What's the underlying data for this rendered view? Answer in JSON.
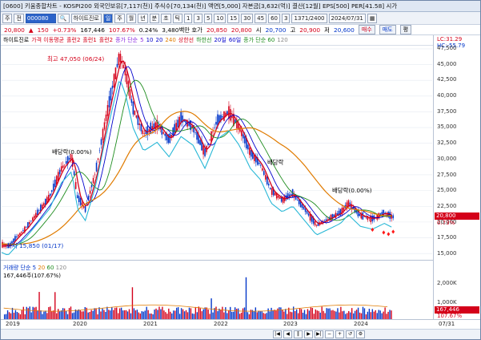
{
  "window": {
    "title": "[0600] 키움종합차트 - KOSPI200 외국인보유[7,117(천)] 주식수[70,134(천)] 액면[5,000] 자본금[3,632(억)] 결산[12월] EPS[500] PER[41.58] 시가"
  },
  "toolbar": {
    "period_labels": [
      "주",
      "전"
    ],
    "code_value": "000080",
    "stock_name": "하이트진로",
    "interval_buttons": [
      "일",
      "주",
      "월",
      "년",
      "분",
      "초",
      "틱"
    ],
    "minute_buttons": [
      "1",
      "3",
      "5",
      "10",
      "15",
      "30",
      "45",
      "60",
      "3"
    ],
    "count_value": "1371",
    "count_total": "2400",
    "date_value": "2024/07/31"
  },
  "pricebar": {
    "price": "20,800",
    "change_arrow": "▲",
    "change": "150",
    "change_pct": "+0.73%",
    "volume": "167,446",
    "volume_ratio": "107.67%",
    "turnover": "0.24%",
    "quote_label": "3,480백만 호가",
    "ask": "20,850",
    "bid": "20,800",
    "open_label": "시",
    "open": "20,700",
    "high_label": "고",
    "high": "20,900",
    "low_label": "저",
    "low": "20,600",
    "buy_btn": "매수",
    "sell_btn": "매도",
    "eval_btn": "평"
  },
  "legend": {
    "items": [
      {
        "text": "하이트진로",
        "color": "#000000"
      },
      {
        "text": "가격 이동평균",
        "color": "#d4001a"
      },
      {
        "text": "홀런2",
        "color": "#d4001a"
      },
      {
        "text": "홀런1",
        "color": "#d4001a"
      },
      {
        "text": "홀런2",
        "color": "#d4001a"
      },
      {
        "text": "종가 단순",
        "color": "#8a2be2"
      },
      {
        "text": "5",
        "color": "#8a2be2"
      },
      {
        "text": "10",
        "color": "#0000cc"
      },
      {
        "text": "20",
        "color": "#0000cc"
      },
      {
        "text": "240",
        "color": "#e07b00"
      },
      {
        "text": "상한선",
        "color": "#d4001a"
      },
      {
        "text": "하한선",
        "color": "#1e8c1e"
      },
      {
        "text": "20일",
        "color": "#0000cc"
      },
      {
        "text": "60일",
        "color": "#0000cc"
      },
      {
        "text": "종가 단순 60",
        "color": "#1e8c1e"
      },
      {
        "text": "120",
        "color": "#888888"
      }
    ]
  },
  "axis": {
    "lc": "LC:31.29",
    "hc": "HC:-55.79",
    "ticks": [
      "47,500",
      "45,000",
      "42,500",
      "40,000",
      "37,500",
      "35,000",
      "32,500",
      "30,000",
      "27,500",
      "25,000",
      "22,500",
      "20,000",
      "17,500",
      "15,000"
    ],
    "current_price": "20,800",
    "current_pct": "0.73%"
  },
  "annotations": {
    "high": "최고 47,050 (06/24)",
    "low": "최저 15,850 (01/17)",
    "div1": "배당락(0.00%)",
    "div2": "배당락",
    "div3": "배당락(0.00%)"
  },
  "volume": {
    "legend": "거래량 단순 5",
    "legend_extra": [
      "20",
      "60",
      "120"
    ],
    "value_line": "167,446주(107.67%)",
    "ticks": [
      "2,000K",
      "1,000K"
    ],
    "current": "167,446",
    "current_pct": "107.67%"
  },
  "xaxis": {
    "labels": [
      "2019",
      "2020",
      "2021",
      "2022",
      "2023",
      "2024"
    ],
    "last": "07/31"
  },
  "colors": {
    "up": "#d4001a",
    "down": "#0035c9",
    "ma_long": "#e07b00",
    "band_lower": "#1e8c1e"
  }
}
